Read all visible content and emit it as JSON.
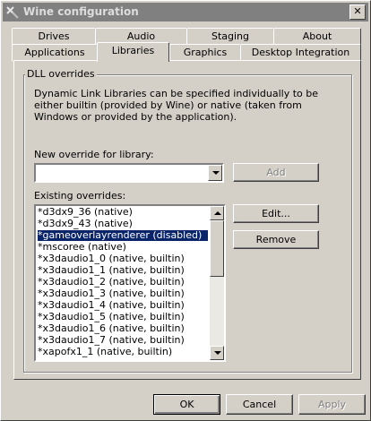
{
  "window": {
    "title": "Wine configuration",
    "close_glyph": "✕"
  },
  "tabs": {
    "row_back": [
      "Drives",
      "Audio",
      "Staging",
      "About"
    ],
    "row_front": [
      "Applications",
      "Libraries",
      "Graphics",
      "Desktop Integration"
    ],
    "active": "Libraries"
  },
  "dll": {
    "group_title": "DLL overrides",
    "description": "Dynamic Link Libraries can be specified individually to be either builtin (provided by Wine) or native (taken from Windows or provided by the application).",
    "new_override_label": "New override for library:",
    "new_override_value": "",
    "add_button": "Add",
    "existing_label": "Existing overrides:",
    "overrides": [
      "*d3dx9_36 (native)",
      "*d3dx9_43 (native)",
      "*gameoverlayrenderer (disabled)",
      "*mscoree (native)",
      "*x3daudio1_0 (native, builtin)",
      "*x3daudio1_1 (native, builtin)",
      "*x3daudio1_2 (native, builtin)",
      "*x3daudio1_3 (native, builtin)",
      "*x3daudio1_4 (native, builtin)",
      "*x3daudio1_5 (native, builtin)",
      "*x3daudio1_6 (native, builtin)",
      "*x3daudio1_7 (native, builtin)",
      "*xapofx1_1 (native, builtin)"
    ],
    "selected_override": "*gameoverlayrenderer (disabled)",
    "edit_button": "Edit...",
    "remove_button": "Remove"
  },
  "footer": {
    "ok": "OK",
    "cancel": "Cancel",
    "apply": "Apply"
  },
  "colors": {
    "selection": "#0a246a",
    "face": "#d4d0c8",
    "title_inactive": "#808080"
  }
}
